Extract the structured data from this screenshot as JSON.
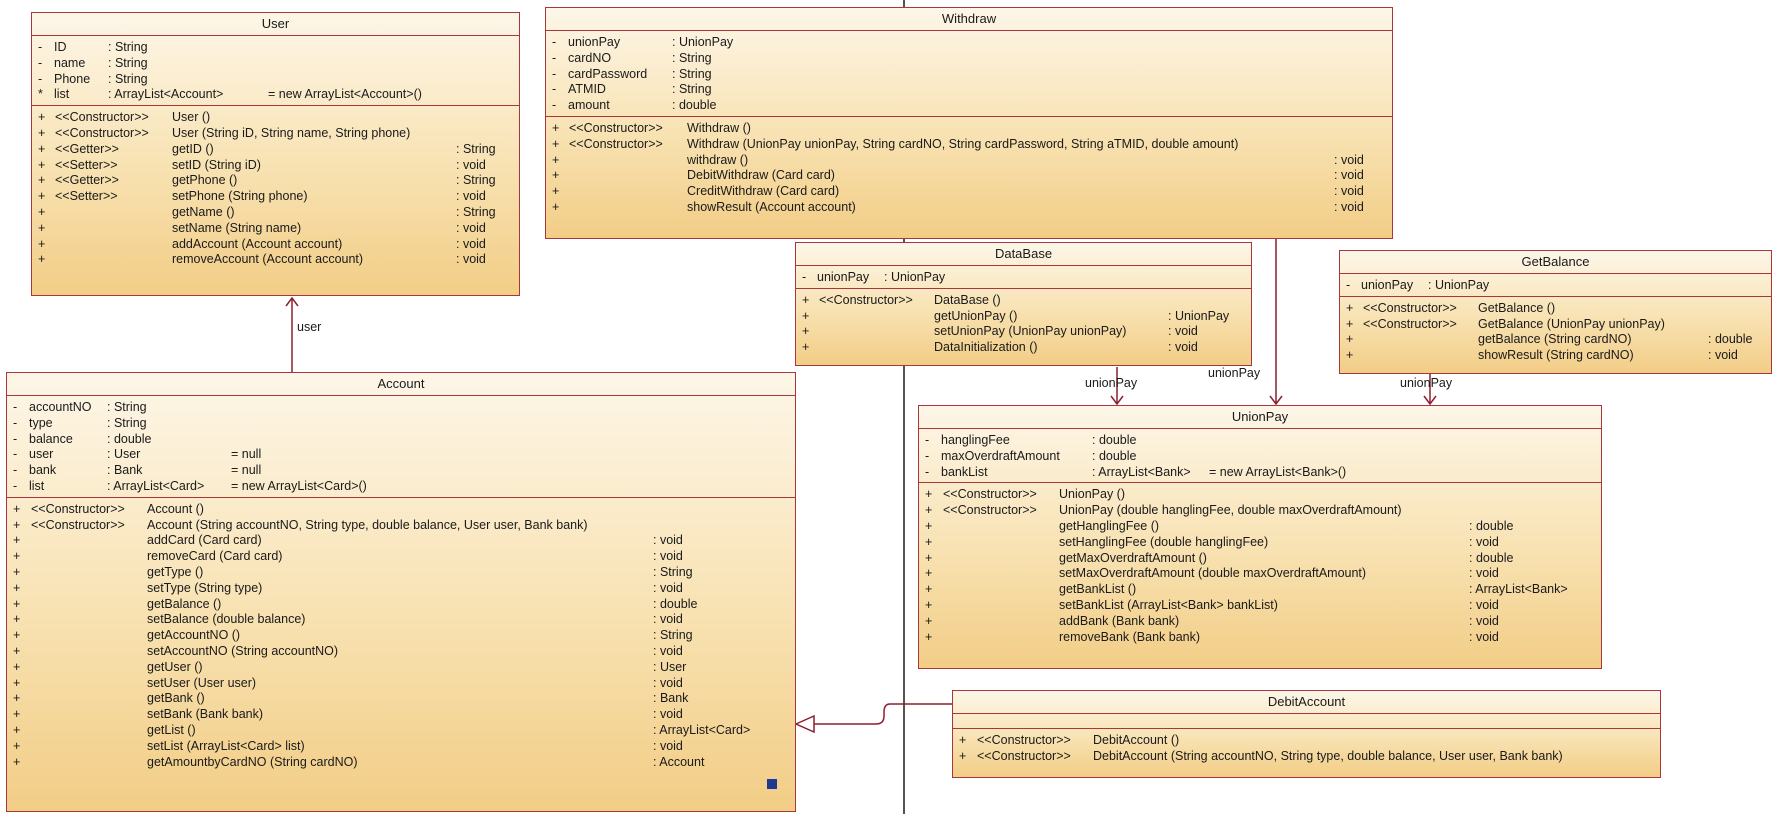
{
  "classes": {
    "user": {
      "name": "User",
      "attributes": [
        {
          "vis": "-",
          "name": "ID",
          "type": ": String",
          "init": ""
        },
        {
          "vis": "-",
          "name": "name",
          "type": ": String",
          "init": ""
        },
        {
          "vis": "-",
          "name": "Phone",
          "type": ": String",
          "init": ""
        },
        {
          "vis": "*",
          "name": "list",
          "type": ": ArrayList<Account>",
          "init": "= new ArrayList<Account>()"
        }
      ],
      "operations": [
        {
          "vis": "+",
          "stereo": "<<Constructor>>",
          "sig": "User ()",
          "ret": ""
        },
        {
          "vis": "+",
          "stereo": "<<Constructor>>",
          "sig": "User (String iD, String name, String phone)",
          "ret": ""
        },
        {
          "vis": "+",
          "stereo": "<<Getter>>",
          "sig": "getID ()",
          "ret": ": String"
        },
        {
          "vis": "+",
          "stereo": "<<Setter>>",
          "sig": "setID (String iD)",
          "ret": ": void"
        },
        {
          "vis": "+",
          "stereo": "<<Getter>>",
          "sig": "getPhone ()",
          "ret": ": String"
        },
        {
          "vis": "+",
          "stereo": "<<Setter>>",
          "sig": "setPhone (String phone)",
          "ret": ": void"
        },
        {
          "vis": "+",
          "stereo": "",
          "sig": "getName ()",
          "ret": ": String"
        },
        {
          "vis": "+",
          "stereo": "",
          "sig": "setName (String name)",
          "ret": ": void"
        },
        {
          "vis": "+",
          "stereo": "",
          "sig": "addAccount (Account account)",
          "ret": ": void"
        },
        {
          "vis": "+",
          "stereo": "",
          "sig": "removeAccount (Account account)",
          "ret": ": void"
        }
      ]
    },
    "withdraw": {
      "name": "Withdraw",
      "attributes": [
        {
          "vis": "-",
          "name": "unionPay",
          "type": ": UnionPay",
          "init": ""
        },
        {
          "vis": "-",
          "name": "cardNO",
          "type": ": String",
          "init": ""
        },
        {
          "vis": "-",
          "name": "cardPassword",
          "type": ": String",
          "init": ""
        },
        {
          "vis": "-",
          "name": "ATMID",
          "type": ": String",
          "init": ""
        },
        {
          "vis": "-",
          "name": "amount",
          "type": ": double",
          "init": ""
        }
      ],
      "operations": [
        {
          "vis": "+",
          "stereo": "<<Constructor>>",
          "sig": "Withdraw ()",
          "ret": ""
        },
        {
          "vis": "+",
          "stereo": "<<Constructor>>",
          "sig": "Withdraw (UnionPay unionPay, String cardNO, String cardPassword, String aTMID, double amount)",
          "ret": ""
        },
        {
          "vis": "+",
          "stereo": "",
          "sig": "withdraw ()",
          "ret": ": void"
        },
        {
          "vis": "+",
          "stereo": "",
          "sig": "DebitWithdraw (Card card)",
          "ret": ": void"
        },
        {
          "vis": "+",
          "stereo": "",
          "sig": "CreditWithdraw (Card card)",
          "ret": ": void"
        },
        {
          "vis": "+",
          "stereo": "",
          "sig": "showResult (Account account)",
          "ret": ": void"
        }
      ]
    },
    "database": {
      "name": "DataBase",
      "attributes": [
        {
          "vis": "-",
          "name": "unionPay",
          "type": ": UnionPay",
          "init": ""
        }
      ],
      "operations": [
        {
          "vis": "+",
          "stereo": "<<Constructor>>",
          "sig": "DataBase ()",
          "ret": ""
        },
        {
          "vis": "+",
          "stereo": "",
          "sig": "getUnionPay ()",
          "ret": ": UnionPay"
        },
        {
          "vis": "+",
          "stereo": "",
          "sig": "setUnionPay (UnionPay unionPay)",
          "ret": ": void"
        },
        {
          "vis": "+",
          "stereo": "",
          "sig": "DataInitialization ()",
          "ret": ": void"
        }
      ]
    },
    "getbalance": {
      "name": "GetBalance",
      "attributes": [
        {
          "vis": "-",
          "name": "unionPay",
          "type": ": UnionPay",
          "init": ""
        }
      ],
      "operations": [
        {
          "vis": "+",
          "stereo": "<<Constructor>>",
          "sig": "GetBalance ()",
          "ret": ""
        },
        {
          "vis": "+",
          "stereo": "<<Constructor>>",
          "sig": "GetBalance (UnionPay unionPay)",
          "ret": ""
        },
        {
          "vis": "+",
          "stereo": "",
          "sig": "getBalance (String cardNO)",
          "ret": ": double"
        },
        {
          "vis": "+",
          "stereo": "",
          "sig": "showResult (String cardNO)",
          "ret": ": void"
        }
      ]
    },
    "account": {
      "name": "Account",
      "attributes": [
        {
          "vis": "-",
          "name": "accountNO",
          "type": ": String",
          "init": ""
        },
        {
          "vis": "-",
          "name": "type",
          "type": ": String",
          "init": ""
        },
        {
          "vis": "-",
          "name": "balance",
          "type": ": double",
          "init": ""
        },
        {
          "vis": "-",
          "name": "user",
          "type": ": User",
          "init": "= null"
        },
        {
          "vis": "-",
          "name": "bank",
          "type": ": Bank",
          "init": "= null"
        },
        {
          "vis": "-",
          "name": "list",
          "type": ": ArrayList<Card>",
          "init": "= new ArrayList<Card>()"
        }
      ],
      "operations": [
        {
          "vis": "+",
          "stereo": "<<Constructor>>",
          "sig": "Account ()",
          "ret": ""
        },
        {
          "vis": "+",
          "stereo": "<<Constructor>>",
          "sig": "Account (String accountNO, String type, double balance, User user, Bank bank)",
          "ret": ""
        },
        {
          "vis": "+",
          "stereo": "",
          "sig": "addCard (Card card)",
          "ret": ": void"
        },
        {
          "vis": "+",
          "stereo": "",
          "sig": "removeCard (Card card)",
          "ret": ": void"
        },
        {
          "vis": "+",
          "stereo": "",
          "sig": "getType ()",
          "ret": ": String"
        },
        {
          "vis": "+",
          "stereo": "",
          "sig": "setType (String type)",
          "ret": ": void"
        },
        {
          "vis": "+",
          "stereo": "",
          "sig": "getBalance ()",
          "ret": ": double"
        },
        {
          "vis": "+",
          "stereo": "",
          "sig": "setBalance (double balance)",
          "ret": ": void"
        },
        {
          "vis": "+",
          "stereo": "",
          "sig": "getAccountNO ()",
          "ret": ": String"
        },
        {
          "vis": "+",
          "stereo": "",
          "sig": "setAccountNO (String accountNO)",
          "ret": ": void"
        },
        {
          "vis": "+",
          "stereo": "",
          "sig": "getUser ()",
          "ret": ": User"
        },
        {
          "vis": "+",
          "stereo": "",
          "sig": "setUser (User user)",
          "ret": ": void"
        },
        {
          "vis": "+",
          "stereo": "",
          "sig": "getBank ()",
          "ret": ": Bank"
        },
        {
          "vis": "+",
          "stereo": "",
          "sig": "setBank (Bank bank)",
          "ret": ": void"
        },
        {
          "vis": "+",
          "stereo": "",
          "sig": "getList ()",
          "ret": ": ArrayList<Card>"
        },
        {
          "vis": "+",
          "stereo": "",
          "sig": "setList (ArrayList<Card> list)",
          "ret": ": void"
        },
        {
          "vis": "+",
          "stereo": "",
          "sig": "getAmountbyCardNO (String cardNO)",
          "ret": ": Account"
        }
      ]
    },
    "unionpay": {
      "name": "UnionPay",
      "attributes": [
        {
          "vis": "-",
          "name": "hanglingFee",
          "type": ": double",
          "init": ""
        },
        {
          "vis": "-",
          "name": "maxOverdraftAmount",
          "type": ": double",
          "init": ""
        },
        {
          "vis": "-",
          "name": "bankList",
          "type": ": ArrayList<Bank>",
          "init": "= new ArrayList<Bank>()"
        }
      ],
      "operations": [
        {
          "vis": "+",
          "stereo": "<<Constructor>>",
          "sig": "UnionPay ()",
          "ret": ""
        },
        {
          "vis": "+",
          "stereo": "<<Constructor>>",
          "sig": "UnionPay (double hanglingFee, double maxOverdraftAmount)",
          "ret": ""
        },
        {
          "vis": "+",
          "stereo": "",
          "sig": "getHanglingFee ()",
          "ret": ": double"
        },
        {
          "vis": "+",
          "stereo": "",
          "sig": "setHanglingFee (double hanglingFee)",
          "ret": ": void"
        },
        {
          "vis": "+",
          "stereo": "",
          "sig": "getMaxOverdraftAmount ()",
          "ret": ": double"
        },
        {
          "vis": "+",
          "stereo": "",
          "sig": "setMaxOverdraftAmount (double maxOverdraftAmount)",
          "ret": ": void"
        },
        {
          "vis": "+",
          "stereo": "",
          "sig": "getBankList ()",
          "ret": ": ArrayList<Bank>"
        },
        {
          "vis": "+",
          "stereo": "",
          "sig": "setBankList (ArrayList<Bank> bankList)",
          "ret": ": void"
        },
        {
          "vis": "+",
          "stereo": "",
          "sig": "addBank (Bank bank)",
          "ret": ": void"
        },
        {
          "vis": "+",
          "stereo": "",
          "sig": "removeBank (Bank bank)",
          "ret": ": void"
        }
      ]
    },
    "debitaccount": {
      "name": "DebitAccount",
      "attributes": [],
      "operations": [
        {
          "vis": "+",
          "stereo": "<<Constructor>>",
          "sig": "DebitAccount ()",
          "ret": ""
        },
        {
          "vis": "+",
          "stereo": "<<Constructor>>",
          "sig": "DebitAccount (String accountNO, String type, double balance, User user, Bank bank)",
          "ret": ""
        }
      ]
    }
  },
  "labels": {
    "user": "user",
    "unionpay_db": "unionPay",
    "unionpay_wd": "unionPay",
    "unionpay_gb": "unionPay"
  },
  "colors": {
    "border": "#a8373c",
    "line": "#8c1f2f",
    "marker": "#1f3a93"
  }
}
